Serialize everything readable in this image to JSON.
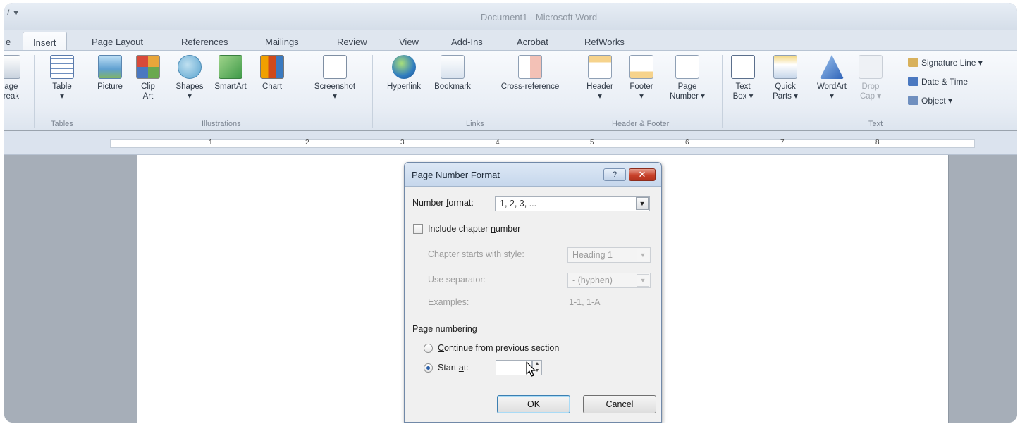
{
  "window": {
    "title": "Document1 - Microsoft Word",
    "quick_access": "/ ▼"
  },
  "tabs": [
    {
      "label": "e"
    },
    {
      "label": "Insert"
    },
    {
      "label": "Page Layout"
    },
    {
      "label": "References"
    },
    {
      "label": "Mailings"
    },
    {
      "label": "Review"
    },
    {
      "label": "View"
    },
    {
      "label": "Add-Ins"
    },
    {
      "label": "Acrobat"
    },
    {
      "label": "RefWorks"
    }
  ],
  "ribbon": {
    "pages": {
      "line1": "Page",
      "line2": "Break"
    },
    "tables": {
      "table": "Table",
      "table_arrow": "▾",
      "group": "Tables"
    },
    "illustrations": {
      "picture": "Picture",
      "clip_line1": "Clip",
      "clip_line2": "Art",
      "shapes": "Shapes",
      "shapes_arrow": "▾",
      "smartart": "SmartArt",
      "chart": "Chart",
      "screenshot": "Screenshot",
      "screenshot_arrow": "▾",
      "group": "Illustrations"
    },
    "links": {
      "hyperlink": "Hyperlink",
      "bookmark": "Bookmark",
      "crossref": "Cross-reference",
      "group": "Links"
    },
    "header_footer": {
      "header": "Header",
      "header_arrow": "▾",
      "footer": "Footer",
      "footer_arrow": "▾",
      "page_line1": "Page",
      "page_line2": "Number ▾",
      "group": "Header & Footer"
    },
    "text": {
      "textbox_line1": "Text",
      "textbox_line2": "Box ▾",
      "quick_line1": "Quick",
      "quick_line2": "Parts ▾",
      "wordart": "WordArt",
      "wordart_arrow": "▾",
      "dropcap_line1": "Drop",
      "dropcap_line2": "Cap ▾",
      "signature": "Signature Line ▾",
      "datetime": "Date & Time",
      "object": "Object ▾",
      "group": "Text"
    }
  },
  "ruler": {
    "numbers": [
      "1",
      "2",
      "3",
      "4",
      "5",
      "6",
      "7",
      "8"
    ]
  },
  "dialog": {
    "title": "Page Number Format",
    "help": "?",
    "close": "✕",
    "number_format_label_pre": "Number ",
    "number_format_label_u": "f",
    "number_format_label_post": "ormat:",
    "number_format_value": "1, 2, 3, ...",
    "include_chapter_pre": "Include chapter ",
    "include_chapter_u": "n",
    "include_chapter_post": "umber",
    "chapter_starts_label": "Chapter starts with style:",
    "chapter_starts_value": "Heading 1",
    "use_separator_label": "Use separator:",
    "use_separator_value": "-  (hyphen)",
    "examples_label": "Examples:",
    "examples_value": "1-1, 1-A",
    "page_numbering_label": "Page numbering",
    "continue_u": "C",
    "continue_post": "ontinue from previous section",
    "start_at_pre": "Start ",
    "start_at_u": "a",
    "start_at_post": "t:",
    "start_at_value": "",
    "ok": "OK",
    "cancel": "Cancel"
  }
}
